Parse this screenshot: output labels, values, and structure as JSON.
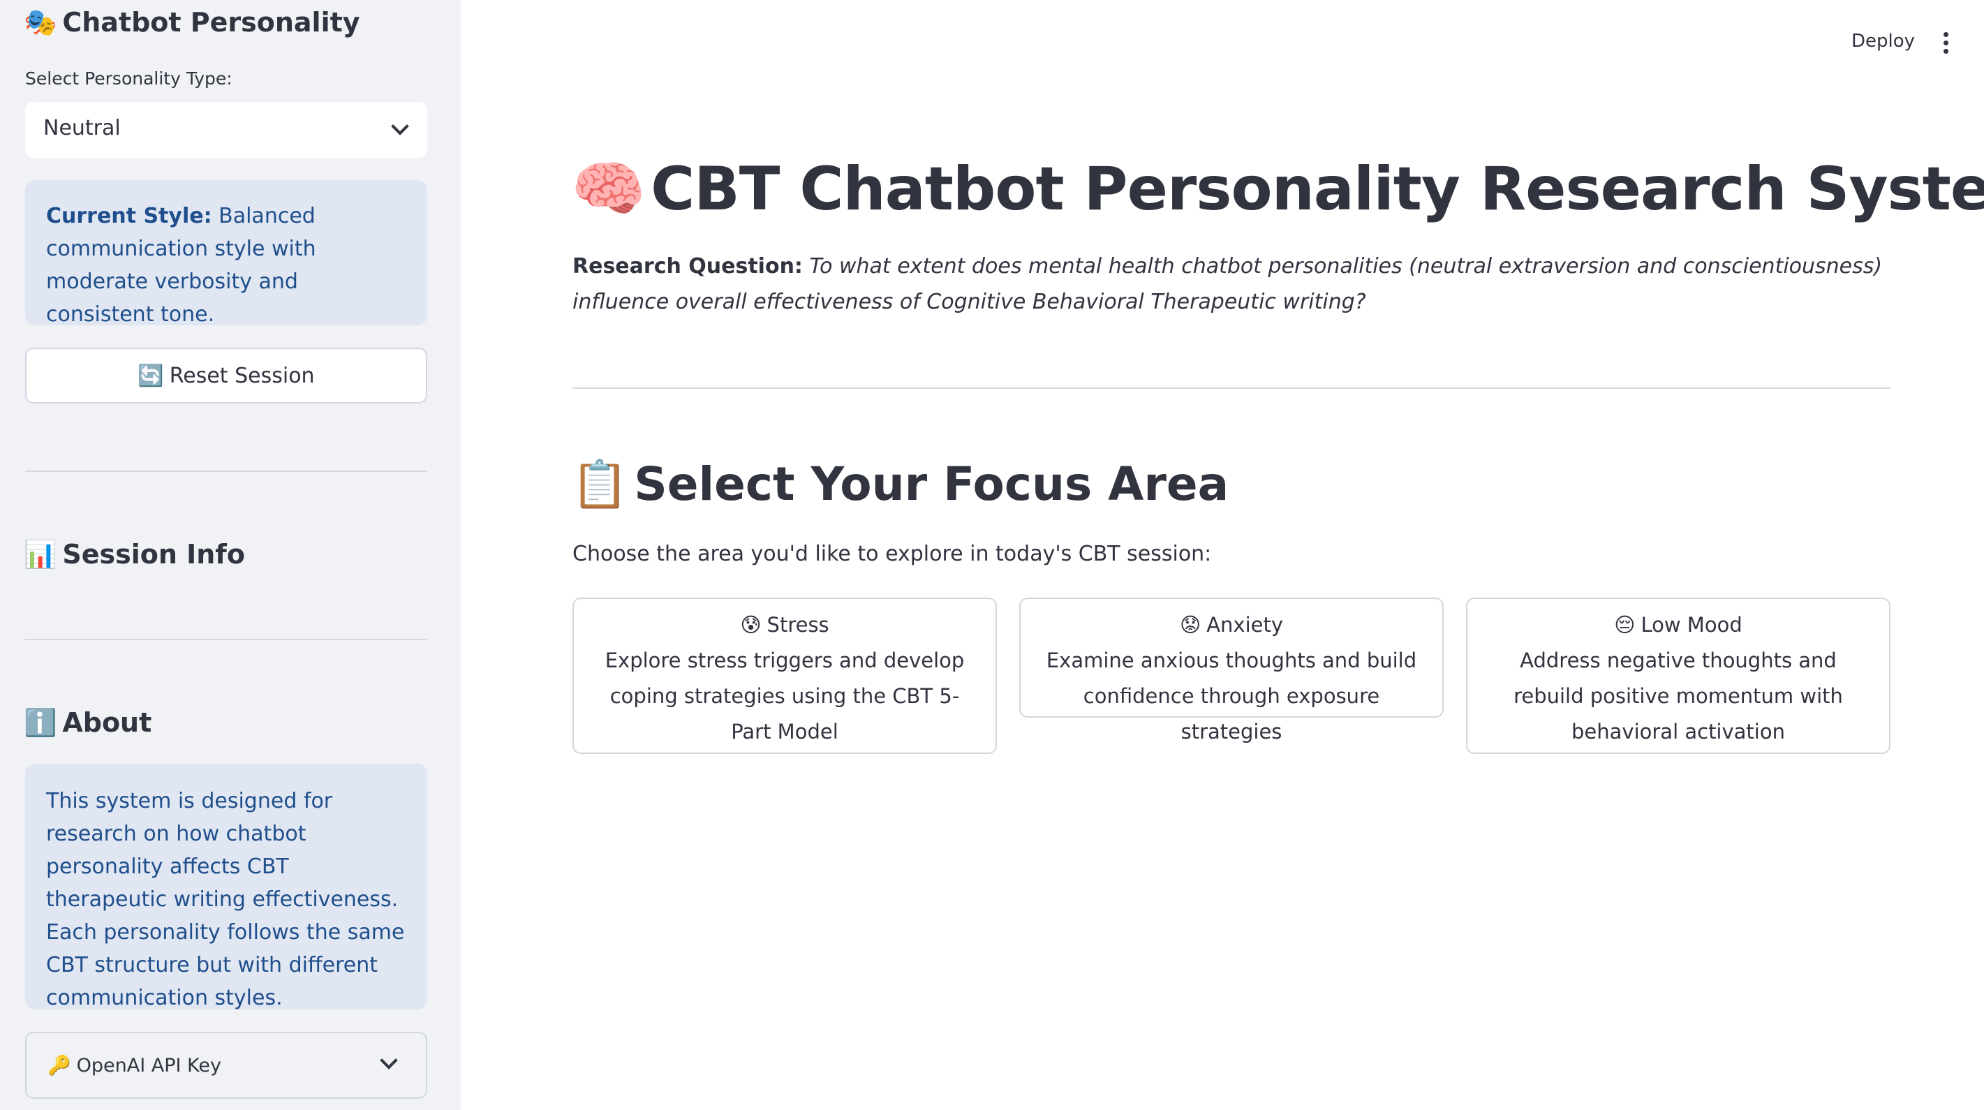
{
  "sidebar": {
    "title_icon": "🎭",
    "title": "Chatbot Personality",
    "select_label": "Select Personality Type:",
    "select_value": "Neutral",
    "style_label": "Current Style:",
    "style_text": " Balanced communication style with moderate verbosity and consistent tone.",
    "reset_icon": "🔄",
    "reset_label": "Reset Session",
    "session_icon": "📊",
    "session_heading": "Session Info",
    "about_icon": "ℹ️",
    "about_heading": "About",
    "about_text": "This system is designed for research on how chatbot personality affects CBT therapeutic writing effectiveness. Each personality follows the same CBT structure but with different communication styles.",
    "api_icon": "🔑",
    "api_label": "OpenAI API Key"
  },
  "header": {
    "deploy_label": "Deploy"
  },
  "main": {
    "title_icon": "🧠",
    "title": "CBT Chatbot Personality Research System",
    "research_label": "Research Question:",
    "research_text": "To what extent does mental health chatbot personalities (neutral extraversion and conscientiousness) influence overall effectiveness of Cognitive Behavioral Therapeutic writing?",
    "focus_icon": "📋",
    "focus_title": "Select Your Focus Area",
    "choose_text": "Choose the area you'd like to explore in today's CBT session:",
    "cards": [
      {
        "icon": "😰",
        "title": "Stress",
        "description": "Explore stress triggers and develop coping strategies using the CBT 5-Part Model"
      },
      {
        "icon": "😟",
        "title": "Anxiety",
        "description": "Examine anxious thoughts and build confidence through exposure strategies"
      },
      {
        "icon": "😔",
        "title": "Low Mood",
        "description": "Address negative thoughts and rebuild positive momentum with behavioral activation"
      }
    ]
  }
}
